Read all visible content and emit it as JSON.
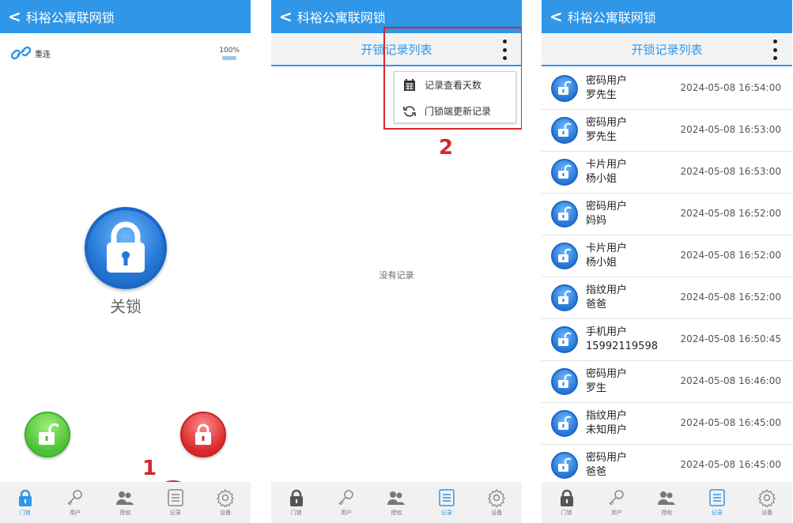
{
  "app_title": "科裕公寓联网锁",
  "back_glyph": "<",
  "tabs": [
    {
      "label": "门锁",
      "icon": "lock-icon"
    },
    {
      "label": "用户",
      "icon": "key-icon"
    },
    {
      "label": "授权",
      "icon": "users-icon"
    },
    {
      "label": "记录",
      "icon": "record-list-icon"
    },
    {
      "label": "设备",
      "icon": "gear-icon"
    }
  ],
  "screen1": {
    "reconnect_label": "重连",
    "battery_text": "100%",
    "lock_state_label": "关锁",
    "annotation": "1"
  },
  "screen2": {
    "subtitle": "开锁记录列表",
    "menu": [
      {
        "label": "记录查看天数",
        "icon": "calendar-icon"
      },
      {
        "label": "门锁端更新记录",
        "icon": "refresh-icon"
      }
    ],
    "empty_text": "没有记录",
    "annotation": "2"
  },
  "screen3": {
    "subtitle": "开锁记录列表",
    "records": [
      {
        "type": "密码用户",
        "name": "罗先生",
        "time": "2024-05-08 16:54:00"
      },
      {
        "type": "密码用户",
        "name": "罗先生",
        "time": "2024-05-08 16:53:00"
      },
      {
        "type": "卡片用户",
        "name": "杨小姐",
        "time": "2024-05-08 16:53:00"
      },
      {
        "type": "密码用户",
        "name": "妈妈",
        "time": "2024-05-08 16:52:00"
      },
      {
        "type": "卡片用户",
        "name": "杨小姐",
        "time": "2024-05-08 16:52:00"
      },
      {
        "type": "指纹用户",
        "name": "爸爸",
        "time": "2024-05-08 16:52:00"
      },
      {
        "type": "手机用户",
        "name": "15992119598",
        "time": "2024-05-08 16:50:45"
      },
      {
        "type": "密码用户",
        "name": "罗生",
        "time": "2024-05-08 16:46:00"
      },
      {
        "type": "指纹用户",
        "name": "未知用户",
        "time": "2024-05-08 16:45:00"
      },
      {
        "type": "密码用户",
        "name": "爸爸",
        "time": "2024-05-08 16:45:00"
      }
    ]
  },
  "colors": {
    "accent": "#2f96e8",
    "annotation": "#d8262b",
    "unlock_green": "#4bc233",
    "lock_red": "#d92828"
  }
}
